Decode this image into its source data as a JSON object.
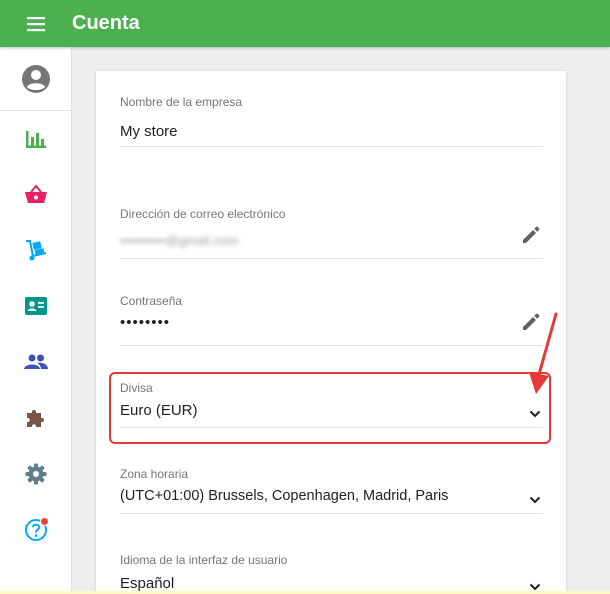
{
  "app": {
    "title": "Cuenta"
  },
  "colors": {
    "topbar": "#4caf50",
    "highlight": "#e53935",
    "badge": "#f44336"
  },
  "sidebar": {
    "items": [
      {
        "name": "avatar",
        "icon": "account-circle-icon"
      },
      {
        "name": "reports",
        "icon": "bar-chart-icon",
        "color": "#4caf50"
      },
      {
        "name": "sales",
        "icon": "basket-icon",
        "color": "#e91e63"
      },
      {
        "name": "inventory",
        "icon": "hand-truck-icon",
        "color": "#03a9f4"
      },
      {
        "name": "customers",
        "icon": "contact-card-icon",
        "color": "#009688"
      },
      {
        "name": "employees",
        "icon": "people-icon",
        "color": "#3f51b5"
      },
      {
        "name": "integrations",
        "icon": "puzzle-icon",
        "color": "#795548"
      },
      {
        "name": "settings",
        "icon": "gear-icon",
        "color": "#607d8b"
      },
      {
        "name": "help",
        "icon": "help-circle-icon",
        "color": "#03a9f4"
      }
    ]
  },
  "form": {
    "business_name": {
      "label": "Nombre de la empresa",
      "value": "My store"
    },
    "email": {
      "label": "Dirección de correo electrónico",
      "value": "••••••••••@gmail.com"
    },
    "password": {
      "label": "Contraseña",
      "value": "••••••••"
    },
    "currency": {
      "label": "Divisa",
      "value": "Euro (EUR)"
    },
    "timezone": {
      "label": "Zona horaria",
      "value": "(UTC+01:00) Brussels, Copenhagen, Madrid, Paris"
    },
    "language": {
      "label": "Idioma de la interfaz de usuario",
      "value": "Español"
    }
  }
}
